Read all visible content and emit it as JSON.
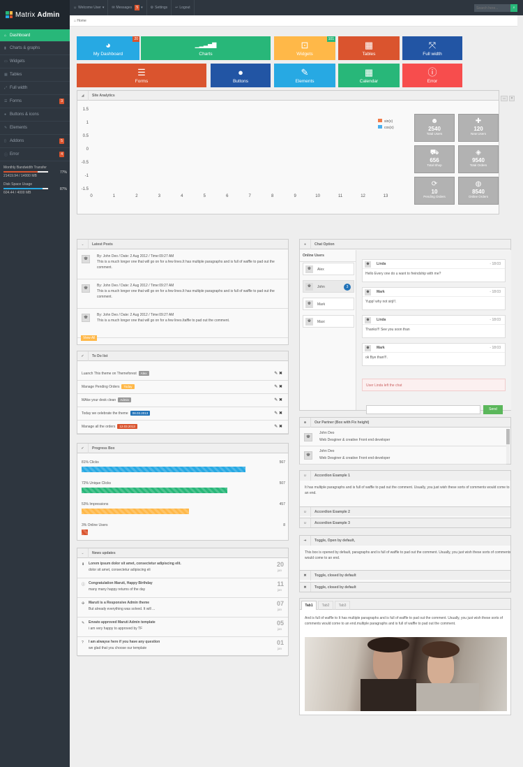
{
  "brand": {
    "name_light": "Matrix",
    "name_bold": "Admin"
  },
  "sidebar": {
    "items": [
      {
        "label": "Dashboard",
        "icon": "home-icon",
        "glyph": "⌂",
        "active": true
      },
      {
        "label": "Charts & graphs",
        "icon": "signal-icon",
        "glyph": "▮"
      },
      {
        "label": "Widgets",
        "icon": "inbox-icon",
        "glyph": "▭"
      },
      {
        "label": "Tables",
        "icon": "table-icon",
        "glyph": "▦"
      },
      {
        "label": "Full width",
        "icon": "fullscreen-icon",
        "glyph": "⤢"
      },
      {
        "label": "Forms",
        "icon": "list-icon",
        "glyph": "☰",
        "badge": "3"
      },
      {
        "label": "Buttons & icons",
        "icon": "tint-icon",
        "glyph": "●"
      },
      {
        "label": "Elements",
        "icon": "pencil-icon",
        "glyph": "✎"
      },
      {
        "label": "Addons",
        "icon": "file-icon",
        "glyph": "▯",
        "badge": "5"
      },
      {
        "label": "Error",
        "icon": "info-icon",
        "glyph": "ⓘ",
        "badge": "4"
      }
    ],
    "stats": [
      {
        "label": "Monthly Bandwidth Transfer",
        "value": "21419.94 / 14000 MB",
        "pct": "77%",
        "fill": 0.77,
        "color": "#da542e"
      },
      {
        "label": "Disk Space Usage",
        "value": "604.44 / 4000 MB",
        "pct": "87%",
        "fill": 0.87,
        "color": "#27a9e3"
      }
    ]
  },
  "topbar": {
    "welcome": "Welcome User",
    "messages": "Messages",
    "messages_count": "5",
    "settings": "Settings",
    "logout": "Logout",
    "search_placeholder": "Search here..."
  },
  "breadcrumb": {
    "home": "Home"
  },
  "tiles_row1": [
    {
      "label": "My Dashboard",
      "icon": "dashboard-icon",
      "glyph": "◕",
      "color": "#27a9e3",
      "badge": "20",
      "badge_color": "#da542e"
    },
    {
      "label": "Charts",
      "icon": "signal-icon",
      "glyph": "▁▂▃▅▇",
      "color": "#28b779"
    },
    {
      "label": "Widgets",
      "icon": "inbox-icon",
      "glyph": "⊡",
      "color": "#ffb848",
      "badge": "101",
      "badge_color": "#28b779"
    },
    {
      "label": "Tables",
      "icon": "table-icon",
      "glyph": "▦",
      "color": "#da542e"
    },
    {
      "label": "Full width",
      "icon": "fullscreen-icon",
      "glyph": "⤧",
      "color": "#2255a4"
    }
  ],
  "tiles_row2": [
    {
      "label": "Forms",
      "icon": "list-icon",
      "glyph": "☰",
      "color": "#da542e"
    },
    {
      "label": "Buttons",
      "icon": "tint-icon",
      "glyph": "●",
      "color": "#2255a4"
    },
    {
      "label": "Elements",
      "icon": "pencil-icon",
      "glyph": "✎",
      "color": "#27a9e3"
    },
    {
      "label": "Calendar",
      "icon": "calendar-icon",
      "glyph": "▦",
      "color": "#28b779"
    },
    {
      "label": "Error",
      "icon": "info-icon",
      "glyph": "ⓘ",
      "color": "#f74d4d"
    }
  ],
  "analytics": {
    "title": "Site Analytics",
    "stats": [
      {
        "value": "2540",
        "label": "Total Users",
        "icon": "user-icon",
        "glyph": "☻"
      },
      {
        "value": "120",
        "label": "New Users",
        "icon": "plus-icon",
        "glyph": "✚"
      },
      {
        "value": "656",
        "label": "Total Shop",
        "icon": "shopping-cart-icon",
        "glyph": "⛟"
      },
      {
        "value": "9540",
        "label": "Total Orders",
        "icon": "tag-icon",
        "glyph": "◈"
      },
      {
        "value": "10",
        "label": "Pending Orders",
        "icon": "repeat-icon",
        "glyph": "⟳"
      },
      {
        "value": "8540",
        "label": "Online Orders",
        "icon": "globe-icon",
        "glyph": "◍"
      }
    ]
  },
  "chart_data": {
    "type": "line",
    "x": [
      0,
      1,
      2,
      3,
      4,
      5,
      6,
      7,
      8,
      9,
      10,
      11,
      12,
      13
    ],
    "xticks": [
      "0",
      "1",
      "2",
      "3",
      "4",
      "5",
      "6",
      "7",
      "8",
      "9",
      "10",
      "11",
      "12",
      "13"
    ],
    "yticks": [
      "1.5",
      "1",
      "0.5",
      "0",
      "-0.5",
      "-1",
      "-1.5"
    ],
    "ylim": [
      -1.5,
      1.5
    ],
    "xlim": [
      0,
      13
    ],
    "grid": false,
    "legend_position": "top-right",
    "series": [
      {
        "name": "sin(x)",
        "color": "#f07c4b",
        "values": []
      },
      {
        "name": "cos(x)",
        "color": "#4bb0ee",
        "values": []
      }
    ]
  },
  "posts": {
    "title": "Latest Posts",
    "items": [
      {
        "meta": "By: John Deo / Date: 2 Aug 2012 / Time:09:27 AM",
        "body": "This is a much longer one that will go on for a few lines.It has multiple paragraphs and is full of waffle to pad out the comment."
      },
      {
        "meta": "By: John Deo / Date: 2 Aug 2012 / Time:09:27 AM",
        "body": "This is a much longer one that will go on for a few lines.It has multiple paragraphs and is full of waffle to pad out the comment."
      },
      {
        "meta": "By: John Deo / Date: 2 Aug 2012 / Time:09:27 AM",
        "body": "This is a much longer one that will go on for a few lines.Itaffle to pad out the comment."
      }
    ],
    "view_all": "View All"
  },
  "todo": {
    "title": "To Do list",
    "items": [
      {
        "text": "Luanch This theme on Themeforest",
        "tag": "Alex",
        "color": "#999"
      },
      {
        "text": "Manage Pending Orders",
        "tag": "Today",
        "color": "#ffb848"
      },
      {
        "text": "MAke your desk clean",
        "tag": "Admin",
        "color": "#999"
      },
      {
        "text": "Today we celebrate the theme",
        "tag": "08.03.2013",
        "color": "#2273b8"
      },
      {
        "text": "Manage all the orders",
        "tag": "12.03.2013",
        "color": "#da542e"
      }
    ]
  },
  "progress": {
    "title": "Progress Box",
    "items": [
      {
        "label": "81% Clicks",
        "value": "567",
        "fill": 0.81,
        "color": "#27a9e3"
      },
      {
        "label": "72% Unique Clicks",
        "value": "507",
        "fill": 0.72,
        "color": "#28b779"
      },
      {
        "label": "53% Impressions",
        "value": "457",
        "fill": 0.53,
        "color": "#ffb848"
      },
      {
        "label": "3% Online Users",
        "value": "8",
        "fill": 0.03,
        "color": "#da542e"
      }
    ]
  },
  "news": {
    "title": "News updates",
    "items": [
      {
        "title": "Lorem ipsum dolor sit amet, consectetur adipiscing elit.",
        "desc": "dolor sit amet, consectetur adipiscing eli",
        "day": "20",
        "month": "jan",
        "icon": "download-icon",
        "glyph": "⬇"
      },
      {
        "title": "Congratulation Maruti, Happy Birthday",
        "desc": "many many happy returns of the day",
        "day": "11",
        "month": "jan",
        "icon": "info-icon",
        "glyph": "ⓘ"
      },
      {
        "title": "Maruti is a Responsive Admin theme",
        "desc": "But already everything was solved. It will ...",
        "day": "07",
        "month": "jan",
        "icon": "move-icon",
        "glyph": "✣"
      },
      {
        "title": "Envato approved Maruti Admin template",
        "desc": "i am very happy to approved by TF",
        "day": "05",
        "month": "jan",
        "icon": "pencil-icon",
        "glyph": "✎"
      },
      {
        "title": "I am alwayse here if you have any question",
        "desc": "we glad that you choose our template",
        "day": "01",
        "month": "jan",
        "icon": "question-icon",
        "glyph": "?"
      }
    ]
  },
  "chat": {
    "title": "Chat Option",
    "online_label": "Online Users",
    "users": [
      {
        "name": "Alex"
      },
      {
        "name": "John",
        "badge": "3"
      },
      {
        "name": "Mark"
      },
      {
        "name": "Maxi"
      }
    ],
    "messages": [
      {
        "name": "Linda",
        "time": "- 18:03",
        "text": "Hello Every one do u want to freindship with me?"
      },
      {
        "name": "Mark",
        "time": "- 18:03",
        "text": "Yupp! why not sirji!!."
      },
      {
        "name": "Linda",
        "time": "- 18:03",
        "text": "Thanks!!! See you soon than"
      },
      {
        "name": "Mark",
        "time": "- 18:03",
        "text": "ok Bye than!!!."
      }
    ],
    "notice": "User Linda left the chat",
    "send_label": "Send"
  },
  "partner": {
    "title": "Our Partner (Box with Fix height)",
    "items": [
      {
        "name": "John Deo",
        "role": "Web Desginer & creative Front end developer"
      },
      {
        "name": "John Deo",
        "role": "Web Desginer & creative Front end developer"
      }
    ]
  },
  "accordion": {
    "first_title": "Accordion Example 1",
    "first_body": "It has multiple paragraphs and is full of waffle to pad out the comment. Usually, you just wish these sorts of comments would come to an end.",
    "second_title": "Accordion Example 2",
    "third_title": "Accordion Example 3"
  },
  "toggle": {
    "open_title": "Toggle, Open by default,",
    "open_body": "This box is opened by default, paragraphs and is full of waffle to pad out the comment. Usually, you just wish these sorts of comments would come to an end.",
    "closed1": "Toggle, closed by default",
    "closed2": "Toggle, closed by default"
  },
  "tabs": {
    "labels": [
      "Tab1",
      "Tab2",
      "Tab3"
    ],
    "body": "And is full of waffle to It has multiple paragraphs and is full of waffle to pad out the comment. Usually, you just wish these sorts of comments would come to an end.multiple paragraphs and is full of waffle to pad out the comment."
  }
}
